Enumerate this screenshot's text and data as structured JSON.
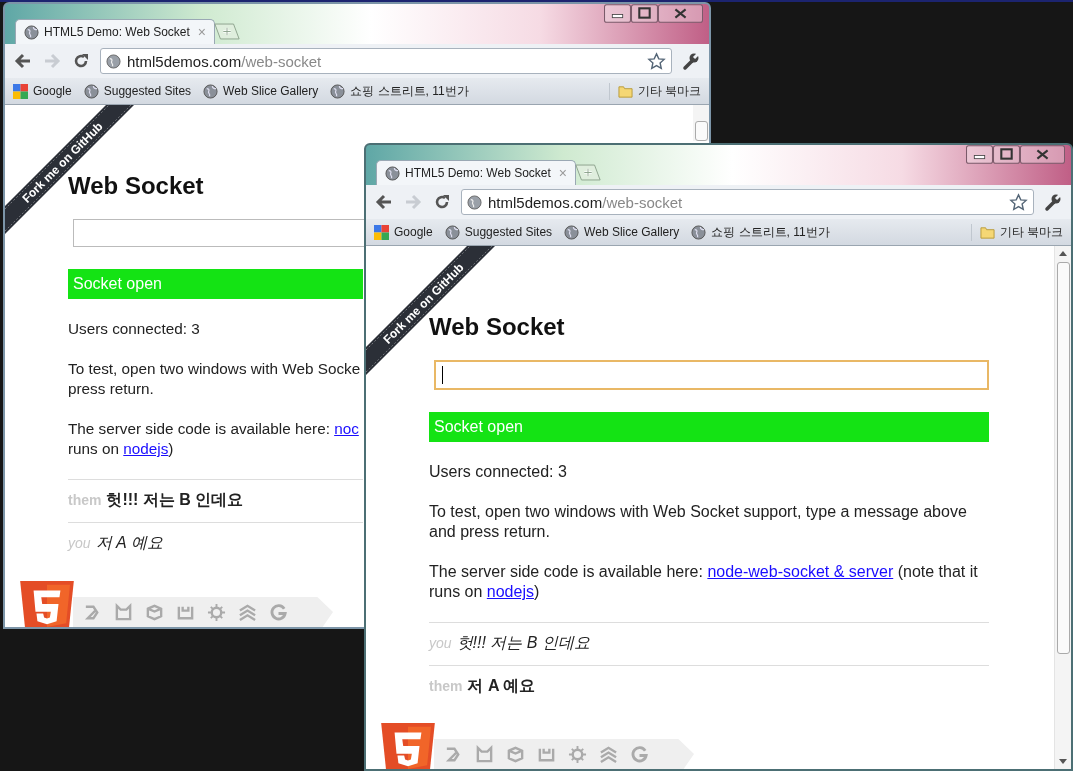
{
  "windows": [
    {
      "tab": {
        "title": "HTML5 Demo: Web Socket",
        "close": "×"
      },
      "address": {
        "host": "html5demos.com",
        "path": "/web-socket"
      },
      "bookmarks": [
        {
          "kind": "google",
          "label": "Google"
        },
        {
          "kind": "globe",
          "label": "Suggested Sites"
        },
        {
          "kind": "globe",
          "label": "Web Slice Gallery"
        },
        {
          "kind": "globe",
          "label": "쇼핑 스트리트, 11번가"
        }
      ],
      "other_bookmarks": "기타 북마크",
      "ribbon": "Fork me on GitHub",
      "heading": "Web Socket",
      "input": {
        "focused": false
      },
      "status": "Socket open",
      "users": "Users connected: 3",
      "paragraphs": [
        {
          "lines": [
            [
              {
                "kind": "text",
                "text": "To test, open two windows with Web Socke"
              }
            ],
            [
              {
                "kind": "text",
                "text": "press return."
              }
            ]
          ]
        },
        {
          "lines": [
            [
              {
                "kind": "text",
                "text": "The server side code is available here: "
              },
              {
                "kind": "link",
                "text": "noc"
              }
            ],
            [
              {
                "kind": "text",
                "text": "runs on "
              },
              {
                "kind": "link",
                "text": "nodejs"
              },
              {
                "kind": "text",
                "text": ")"
              }
            ]
          ]
        }
      ],
      "messages": [
        {
          "kind": "them",
          "sender": "them",
          "text": "헛!!! 저는 B 인데요"
        },
        {
          "kind": "you",
          "sender": "you",
          "text": "저 A 예요"
        }
      ]
    },
    {
      "tab": {
        "title": "HTML5 Demo: Web Socket",
        "close": "×"
      },
      "address": {
        "host": "html5demos.com",
        "path": "/web-socket"
      },
      "bookmarks": [
        {
          "kind": "google",
          "label": "Google"
        },
        {
          "kind": "globe",
          "label": "Suggested Sites"
        },
        {
          "kind": "globe",
          "label": "Web Slice Gallery"
        },
        {
          "kind": "globe",
          "label": "쇼핑 스트리트, 11번가"
        }
      ],
      "other_bookmarks": "기타 북마크",
      "ribbon": "Fork me on GitHub",
      "heading": "Web Socket",
      "input": {
        "focused": true
      },
      "status": "Socket open",
      "users": "Users connected: 3",
      "paragraphs": [
        {
          "lines": [
            [
              {
                "kind": "text",
                "text": "To test, open two windows with Web Socket support, type a message above and press return."
              }
            ]
          ]
        },
        {
          "lines": [
            [
              {
                "kind": "text",
                "text": "The server side code is available here: "
              },
              {
                "kind": "link",
                "text": "node-web-socket & server"
              },
              {
                "kind": "text",
                "text": " (note that it runs on "
              },
              {
                "kind": "link",
                "text": "nodejs"
              },
              {
                "kind": "text",
                "text": ")"
              }
            ]
          ]
        }
      ],
      "messages": [
        {
          "kind": "you",
          "sender": "you",
          "text": "헛!!! 저는 B 인데요"
        },
        {
          "kind": "them",
          "sender": "them",
          "text": "저 A 예요"
        }
      ]
    }
  ]
}
